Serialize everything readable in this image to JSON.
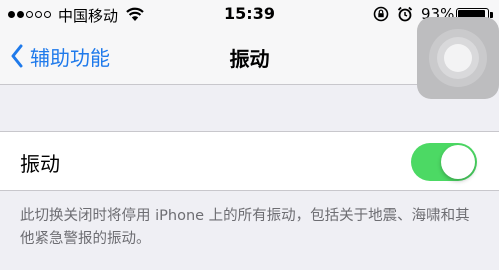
{
  "status_bar": {
    "signal_strength": "2 of 5",
    "carrier": "中国移动",
    "wifi_icon": "wifi-icon",
    "time": "15:39",
    "orientation_lock_icon": "orientation-lock-icon",
    "alarm_icon": "alarm-icon",
    "battery_percent": "93%",
    "battery_level": 0.93
  },
  "nav": {
    "back_label": "辅助功能",
    "title": "振动",
    "back_icon": "chevron-left-icon"
  },
  "assistive_touch": {
    "icon": "assistive-touch-icon"
  },
  "settings": {
    "vibration_label": "振动",
    "vibration_on": true,
    "footer": "此切换关闭时将停用 iPhone 上的所有振动，包括关于地震、海啸和其他紧急警报的振动。"
  },
  "colors": {
    "accent": "#1f7aeb",
    "toggle_on": "#4cd964",
    "background": "#efeff4",
    "footer_text": "#6d6d72"
  }
}
